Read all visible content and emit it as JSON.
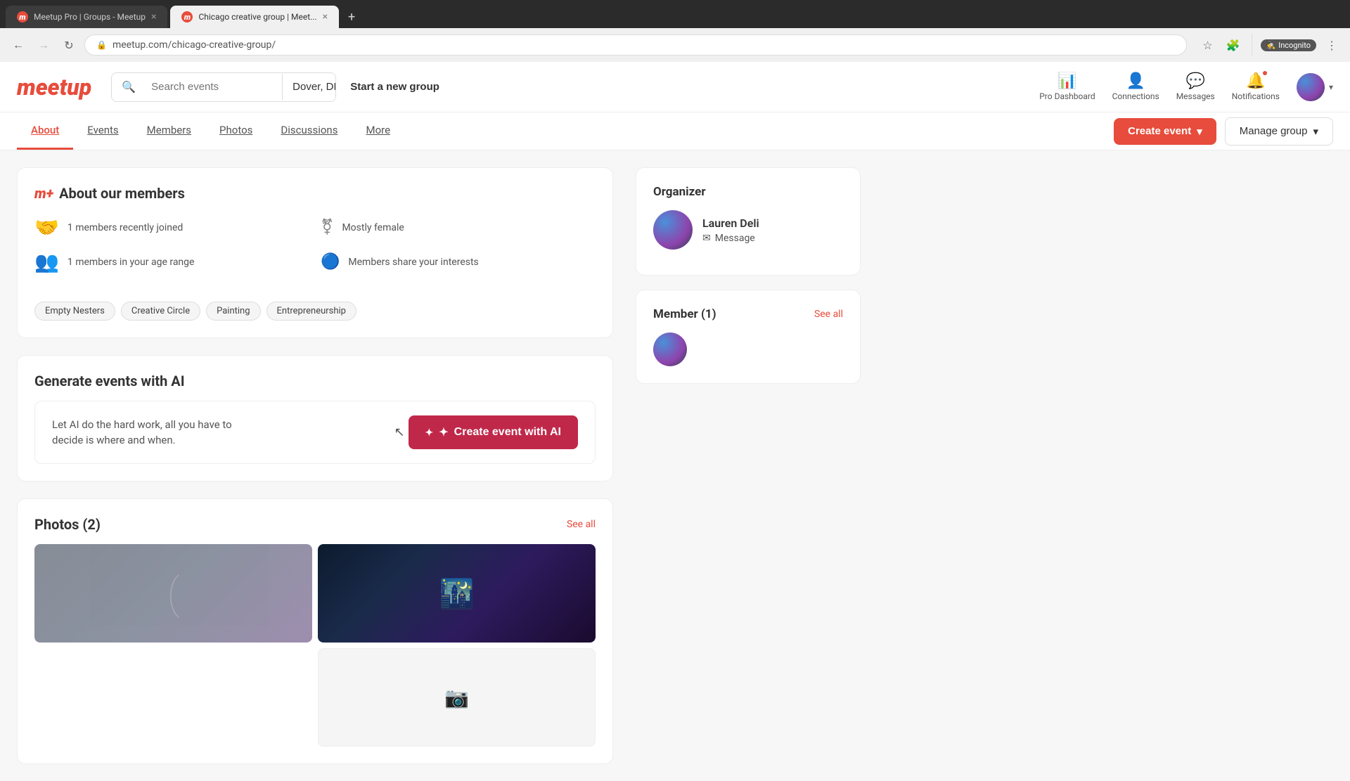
{
  "browser": {
    "tabs": [
      {
        "id": "tab1",
        "title": "Meetup Pro | Groups - Meetup",
        "url": "meetup.com/chicago-creative-group/",
        "active": false,
        "favicon": "M"
      },
      {
        "id": "tab2",
        "title": "Chicago creative group | Meet...",
        "url": "meetup.com/chicago-creative-group/",
        "active": true,
        "favicon": "M"
      }
    ],
    "url": "meetup.com/chicago-creative-group/",
    "incognito_label": "Incognito"
  },
  "header": {
    "logo": "meetup",
    "search_placeholder": "Search events",
    "location_value": "Dover, DE",
    "start_group_label": "Start a new group",
    "nav_items": [
      {
        "id": "pro-dashboard",
        "label": "Pro Dashboard",
        "icon": "📊"
      },
      {
        "id": "connections",
        "label": "Connections",
        "icon": "👤"
      },
      {
        "id": "messages",
        "label": "Messages",
        "icon": "💬"
      },
      {
        "id": "notifications",
        "label": "Notifications",
        "icon": "🔔",
        "has_badge": true
      }
    ]
  },
  "sub_nav": {
    "items": [
      {
        "id": "about",
        "label": "About",
        "active": true
      },
      {
        "id": "events",
        "label": "Events",
        "active": false
      },
      {
        "id": "members",
        "label": "Members",
        "active": false
      },
      {
        "id": "photos",
        "label": "Photos",
        "active": false
      },
      {
        "id": "discussions",
        "label": "Discussions",
        "active": false
      },
      {
        "id": "more",
        "label": "More",
        "active": false
      }
    ],
    "create_event_label": "Create event",
    "manage_group_label": "Manage group"
  },
  "about_members": {
    "title": "About our members",
    "stats": [
      {
        "id": "recently-joined",
        "icon": "🤝",
        "text": "1 members recently joined"
      },
      {
        "id": "gender",
        "icon": "⚧",
        "text": "Mostly female"
      },
      {
        "id": "age-range",
        "icon": "👥",
        "text": "1 members in your age range"
      },
      {
        "id": "interests",
        "icon": "🔵",
        "text": "Members share your interests"
      }
    ],
    "interests_label": "Members share your interests",
    "tags": [
      "Empty Nesters",
      "Creative Circle",
      "Painting",
      "Entrepreneurship"
    ]
  },
  "ai_section": {
    "title": "Generate events with AI",
    "description": "Let AI do the hard work, all you have to decide is where and when.",
    "button_label": "Create event with AI"
  },
  "photos_section": {
    "title": "Photos (2)",
    "see_all_label": "See all"
  },
  "organizer": {
    "section_title": "Organizer",
    "name": "Lauren Deli",
    "message_label": "Message"
  },
  "member_section": {
    "title": "Member (1)",
    "see_all_label": "See all",
    "count": 1
  },
  "colors": {
    "brand_red": "#e74c3c",
    "dark_red": "#c0284a",
    "link_blue": "#2196F3"
  }
}
